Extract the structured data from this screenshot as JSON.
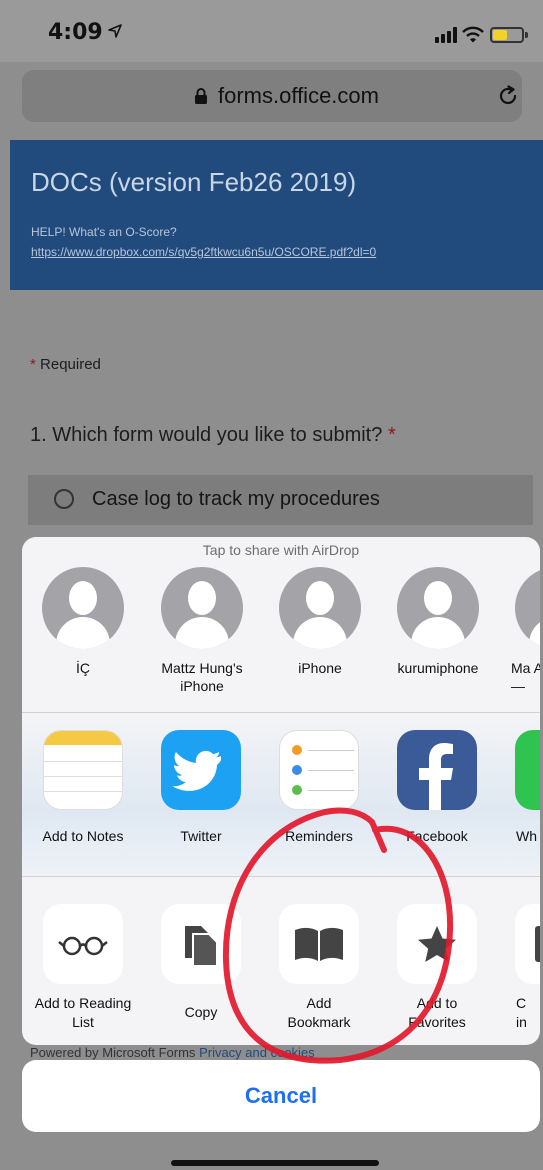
{
  "status_bar": {
    "time": "4:09",
    "icons": [
      "location-arrow-icon",
      "cellular-signal-icon",
      "wifi-icon",
      "battery-icon"
    ]
  },
  "browser": {
    "url": "forms.office.com",
    "icons": [
      "lock-icon",
      "reload-icon"
    ]
  },
  "form": {
    "title": "DOCs (version Feb26 2019)",
    "help_text": "HELP! What's an O-Score?",
    "help_link": "https://www.dropbox.com/s/qv5g2ftkwcu6n5u/OSCORE.pdf?dl=0",
    "required_star": "*",
    "required_label": "Required",
    "question": "1. Which form would you like to submit?",
    "question_star": "*",
    "option": "Case log to track my procedures",
    "footer_powered": "Powered by Microsoft Forms",
    "footer_link": "Privacy and cookies",
    "header_color": "#214a7d"
  },
  "share_sheet": {
    "airdrop_caption": "Tap to share with AirDrop",
    "contacts": [
      {
        "name": "İÇ",
        "icon": "person-avatar-icon"
      },
      {
        "name": "Mattz Hung's iPhone",
        "icon": "person-avatar-icon"
      },
      {
        "name": "iPhone",
        "icon": "person-avatar-icon"
      },
      {
        "name": "kurumiphone",
        "icon": "person-avatar-icon"
      },
      {
        "name": "Ma Air —",
        "icon": "person-avatar-icon"
      }
    ],
    "apps": [
      {
        "label": "Add to Notes",
        "icon": "notes-app-icon"
      },
      {
        "label": "Twitter",
        "icon": "twitter-app-icon"
      },
      {
        "label": "Reminders",
        "icon": "reminders-app-icon"
      },
      {
        "label": "Facebook",
        "icon": "facebook-app-icon"
      },
      {
        "label": "Wh",
        "icon": "whatsapp-app-icon"
      }
    ],
    "actions": [
      {
        "label": "Add to Reading List",
        "icon": "glasses-icon"
      },
      {
        "label": "Copy",
        "icon": "copy-icon"
      },
      {
        "label": "Add Bookmark",
        "icon": "book-icon"
      },
      {
        "label": "Add to Favorites",
        "icon": "star-icon"
      },
      {
        "label": "C in",
        "icon": "partial-action-icon"
      }
    ],
    "cancel_label": "Cancel",
    "accent_color": "#1f6ff2",
    "annotation_color": "#e2192c"
  }
}
